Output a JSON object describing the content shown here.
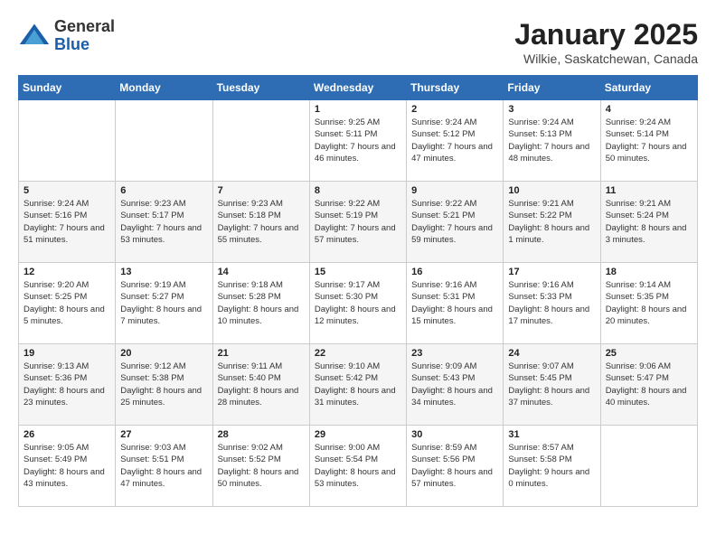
{
  "header": {
    "logo_general": "General",
    "logo_blue": "Blue",
    "month_title": "January 2025",
    "location": "Wilkie, Saskatchewan, Canada"
  },
  "days_of_week": [
    "Sunday",
    "Monday",
    "Tuesday",
    "Wednesday",
    "Thursday",
    "Friday",
    "Saturday"
  ],
  "weeks": [
    [
      {
        "day": "",
        "info": ""
      },
      {
        "day": "",
        "info": ""
      },
      {
        "day": "",
        "info": ""
      },
      {
        "day": "1",
        "info": "Sunrise: 9:25 AM\nSunset: 5:11 PM\nDaylight: 7 hours and 46 minutes."
      },
      {
        "day": "2",
        "info": "Sunrise: 9:24 AM\nSunset: 5:12 PM\nDaylight: 7 hours and 47 minutes."
      },
      {
        "day": "3",
        "info": "Sunrise: 9:24 AM\nSunset: 5:13 PM\nDaylight: 7 hours and 48 minutes."
      },
      {
        "day": "4",
        "info": "Sunrise: 9:24 AM\nSunset: 5:14 PM\nDaylight: 7 hours and 50 minutes."
      }
    ],
    [
      {
        "day": "5",
        "info": "Sunrise: 9:24 AM\nSunset: 5:16 PM\nDaylight: 7 hours and 51 minutes."
      },
      {
        "day": "6",
        "info": "Sunrise: 9:23 AM\nSunset: 5:17 PM\nDaylight: 7 hours and 53 minutes."
      },
      {
        "day": "7",
        "info": "Sunrise: 9:23 AM\nSunset: 5:18 PM\nDaylight: 7 hours and 55 minutes."
      },
      {
        "day": "8",
        "info": "Sunrise: 9:22 AM\nSunset: 5:19 PM\nDaylight: 7 hours and 57 minutes."
      },
      {
        "day": "9",
        "info": "Sunrise: 9:22 AM\nSunset: 5:21 PM\nDaylight: 7 hours and 59 minutes."
      },
      {
        "day": "10",
        "info": "Sunrise: 9:21 AM\nSunset: 5:22 PM\nDaylight: 8 hours and 1 minute."
      },
      {
        "day": "11",
        "info": "Sunrise: 9:21 AM\nSunset: 5:24 PM\nDaylight: 8 hours and 3 minutes."
      }
    ],
    [
      {
        "day": "12",
        "info": "Sunrise: 9:20 AM\nSunset: 5:25 PM\nDaylight: 8 hours and 5 minutes."
      },
      {
        "day": "13",
        "info": "Sunrise: 9:19 AM\nSunset: 5:27 PM\nDaylight: 8 hours and 7 minutes."
      },
      {
        "day": "14",
        "info": "Sunrise: 9:18 AM\nSunset: 5:28 PM\nDaylight: 8 hours and 10 minutes."
      },
      {
        "day": "15",
        "info": "Sunrise: 9:17 AM\nSunset: 5:30 PM\nDaylight: 8 hours and 12 minutes."
      },
      {
        "day": "16",
        "info": "Sunrise: 9:16 AM\nSunset: 5:31 PM\nDaylight: 8 hours and 15 minutes."
      },
      {
        "day": "17",
        "info": "Sunrise: 9:16 AM\nSunset: 5:33 PM\nDaylight: 8 hours and 17 minutes."
      },
      {
        "day": "18",
        "info": "Sunrise: 9:14 AM\nSunset: 5:35 PM\nDaylight: 8 hours and 20 minutes."
      }
    ],
    [
      {
        "day": "19",
        "info": "Sunrise: 9:13 AM\nSunset: 5:36 PM\nDaylight: 8 hours and 23 minutes."
      },
      {
        "day": "20",
        "info": "Sunrise: 9:12 AM\nSunset: 5:38 PM\nDaylight: 8 hours and 25 minutes."
      },
      {
        "day": "21",
        "info": "Sunrise: 9:11 AM\nSunset: 5:40 PM\nDaylight: 8 hours and 28 minutes."
      },
      {
        "day": "22",
        "info": "Sunrise: 9:10 AM\nSunset: 5:42 PM\nDaylight: 8 hours and 31 minutes."
      },
      {
        "day": "23",
        "info": "Sunrise: 9:09 AM\nSunset: 5:43 PM\nDaylight: 8 hours and 34 minutes."
      },
      {
        "day": "24",
        "info": "Sunrise: 9:07 AM\nSunset: 5:45 PM\nDaylight: 8 hours and 37 minutes."
      },
      {
        "day": "25",
        "info": "Sunrise: 9:06 AM\nSunset: 5:47 PM\nDaylight: 8 hours and 40 minutes."
      }
    ],
    [
      {
        "day": "26",
        "info": "Sunrise: 9:05 AM\nSunset: 5:49 PM\nDaylight: 8 hours and 43 minutes."
      },
      {
        "day": "27",
        "info": "Sunrise: 9:03 AM\nSunset: 5:51 PM\nDaylight: 8 hours and 47 minutes."
      },
      {
        "day": "28",
        "info": "Sunrise: 9:02 AM\nSunset: 5:52 PM\nDaylight: 8 hours and 50 minutes."
      },
      {
        "day": "29",
        "info": "Sunrise: 9:00 AM\nSunset: 5:54 PM\nDaylight: 8 hours and 53 minutes."
      },
      {
        "day": "30",
        "info": "Sunrise: 8:59 AM\nSunset: 5:56 PM\nDaylight: 8 hours and 57 minutes."
      },
      {
        "day": "31",
        "info": "Sunrise: 8:57 AM\nSunset: 5:58 PM\nDaylight: 9 hours and 0 minutes."
      },
      {
        "day": "",
        "info": ""
      }
    ]
  ]
}
